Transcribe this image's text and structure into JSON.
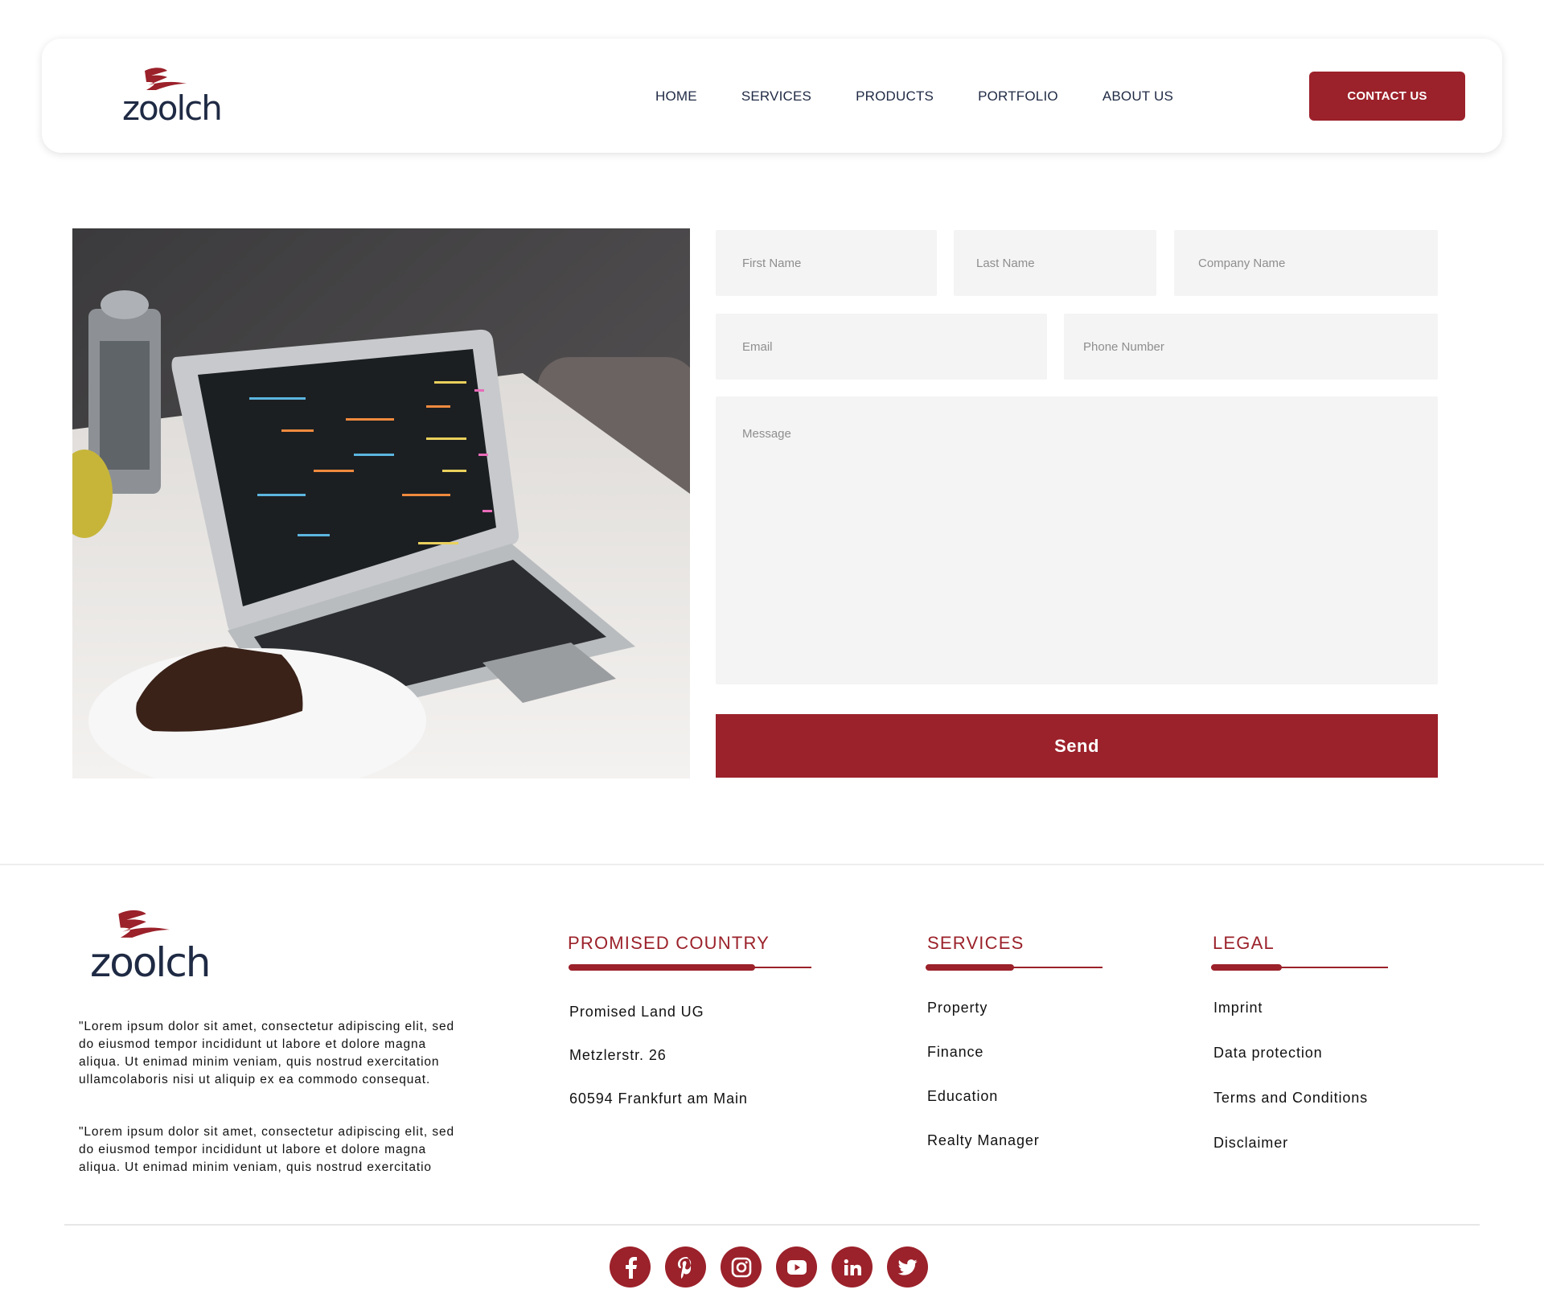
{
  "brand": {
    "name": "zoolch",
    "accent_color": "#9b212a",
    "text_color": "#1f2a44"
  },
  "header": {
    "nav": [
      "HOME",
      "SERVICES",
      "PRODUCTS",
      "PORTFOLIO",
      "ABOUT US"
    ],
    "contact_label": "CONTACT US"
  },
  "hero_image": {
    "subject": "laptop with code on a table",
    "icon": "photo"
  },
  "form": {
    "first_name_placeholder": "First Name",
    "last_name_placeholder": "Last Name",
    "company_placeholder": "Company Name",
    "email_placeholder": "Email",
    "phone_placeholder": "Phone Number",
    "message_placeholder": "Message",
    "send_label": "Send"
  },
  "footer": {
    "about": [
      "\"Lorem ipsum dolor sit amet, consectetur adipiscing elit, sed do eiusmod tempor incididunt ut labore et dolore magna aliqua. Ut enimad minim veniam, quis nostrud exercitation ullamcolaboris nisi ut aliquip ex ea commodo consequat.",
      "\"Lorem ipsum dolor sit amet, consectetur adipiscing elit, sed do eiusmod tempor incididunt ut labore et dolore magna aliqua. Ut enimad minim veniam, quis nostrud exercitatio"
    ],
    "columns": {
      "country": {
        "title": "PROMISED COUNTRY",
        "items": [
          "Promised Land UG",
          "Metzlerstr. 26",
          "60594 Frankfurt am Main"
        ]
      },
      "services": {
        "title": "SERVICES",
        "items": [
          "Property",
          "Finance",
          "Education",
          "Realty Manager"
        ]
      },
      "legal": {
        "title": "LEGAL",
        "items": [
          "Imprint",
          "Data protection",
          "Terms and Conditions",
          "Disclaimer"
        ]
      }
    },
    "social": [
      "facebook-icon",
      "pinterest-icon",
      "instagram-icon",
      "youtube-icon",
      "linkedin-icon",
      "twitter-icon"
    ]
  }
}
